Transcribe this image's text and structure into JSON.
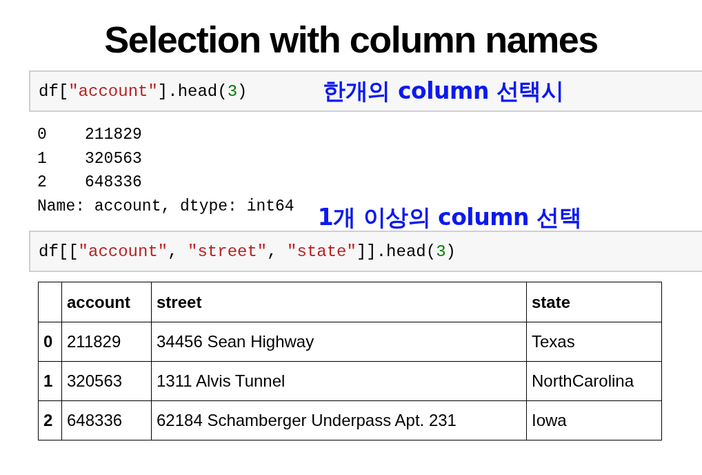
{
  "title": "Selection with column names",
  "cells": [
    {
      "code": [
        {
          "kind": "plain",
          "text": "df["
        },
        {
          "kind": "string",
          "text": "\"account\""
        },
        {
          "kind": "plain",
          "text": "].head("
        },
        {
          "kind": "number",
          "text": "3"
        },
        {
          "kind": "plain",
          "text": ")"
        }
      ],
      "note": "한개의 column 선택시",
      "output": [
        "0    211829",
        "1    320563",
        "2    648336",
        "Name: account, dtype: int64"
      ],
      "output_note": "1개 이상의 column 선택"
    },
    {
      "code": [
        {
          "kind": "plain",
          "text": "df[["
        },
        {
          "kind": "string",
          "text": "\"account\""
        },
        {
          "kind": "plain",
          "text": ", "
        },
        {
          "kind": "string",
          "text": "\"street\""
        },
        {
          "kind": "plain",
          "text": ", "
        },
        {
          "kind": "string",
          "text": "\"state\""
        },
        {
          "kind": "plain",
          "text": "]].head("
        },
        {
          "kind": "number",
          "text": "3"
        },
        {
          "kind": "plain",
          "text": ")"
        }
      ]
    }
  ],
  "table": {
    "columns": [
      "",
      "account",
      "street",
      "state"
    ],
    "rows": [
      [
        "0",
        "211829",
        "34456 Sean Highway",
        "Texas"
      ],
      [
        "1",
        "320563",
        "1311 Alvis Tunnel",
        "NorthCarolina"
      ],
      [
        "2",
        "648336",
        "62184 Schamberger Underpass Apt. 231",
        "Iowa"
      ]
    ]
  }
}
